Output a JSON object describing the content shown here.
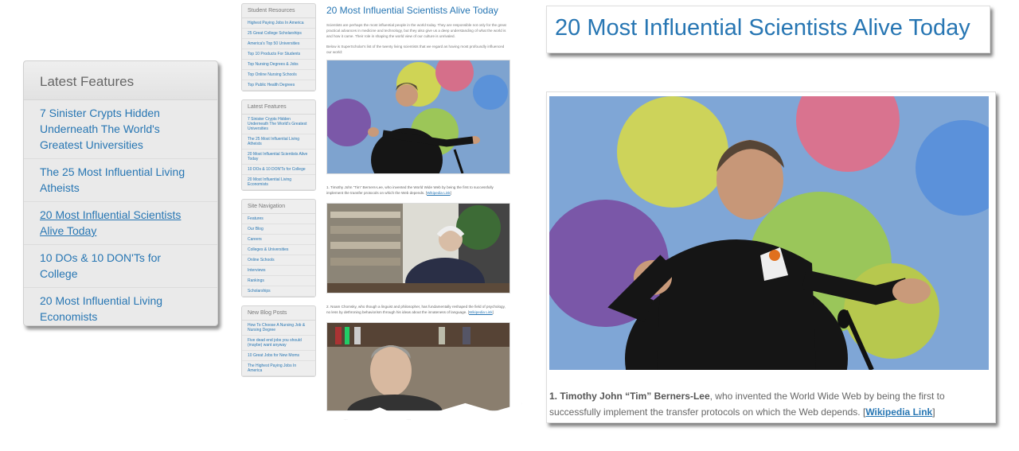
{
  "latest_features": {
    "heading": "Latest Features",
    "items": [
      {
        "line1": "7 Sinister Crypts Hidden",
        "line2": "Underneath The World's",
        "line3": "Greatest Universities"
      },
      {
        "line1": "The 25 Most Influential Living",
        "line2": "Atheists"
      },
      {
        "line1": "20 Most Influential Scientists",
        "line2": "Alive Today"
      },
      {
        "line1": "10 DOs & 10 DON'Ts for",
        "line2": "College"
      },
      {
        "line1": "20 Most Influential Living",
        "line2": "Economists"
      }
    ]
  },
  "sidebar": {
    "student_resources": {
      "heading": "Student Resources",
      "items": [
        "Highest Paying Jobs In America",
        "25 Great College Scholarships",
        "America's Top 50 Universities",
        "Top 10 Products For Students",
        "Top Nursing Degrees & Jobs",
        "Top Online Nursing Schools",
        "Top Public Health Degrees"
      ]
    },
    "latest_features": {
      "heading": "Latest Features",
      "items": [
        "7 Sinister Crypts Hidden Underneath The World's Greatest Universities",
        "The 25 Most Influential Living Atheists",
        "20 Most Influential Scientists Alive Today",
        "10 DOs & 10 DON'Ts for College",
        "20 Most Influential Living Economists"
      ]
    },
    "site_navigation": {
      "heading": "Site Navigation",
      "items": [
        "Features",
        "Our Blog",
        "Careers",
        "Colleges & Universities",
        "Online Schools",
        "Interviews",
        "Rankings",
        "Scholarships"
      ]
    },
    "new_blog_posts": {
      "heading": "New Blog Posts",
      "items": [
        "How To Choose A Nursing Job & Nursing Degree",
        "Five dead end jobs you should (maybe) want anyway",
        "10 Great Jobs for New Moms",
        "The Highest Paying Jobs In America"
      ]
    }
  },
  "article": {
    "title": "20 Most Influential Scientists Alive Today",
    "intro": "Scientists are perhaps the most influential people in the world today. They are responsible not only for the great practical advances in medicine and technology, but they also give us a deep understanding of what the world is and how it came. Their role in shaping the world view of our culture is unrivaled.",
    "intro2": "Below is SuperScholar's list of the twenty living scientists that we regard as having most profoundly influenced our world:",
    "entries": [
      {
        "num": "1.",
        "name": "Timothy John “Tim” Berners-Lee",
        "text": ", who invented the World Wide Web by being the first to successfully implement the transfer protocols on which the Web depends. ",
        "link": "Wikipedia Link"
      },
      {
        "num": "2.",
        "name": "Noam Chomsky",
        "text": ", who though a linguist and philosopher, has fundamentally reshaped the field of psychology, no less by dethroning behaviorism through his ideas about the innateness of language. ",
        "link": "Wikipedia Link"
      }
    ]
  },
  "banner_title": "20 Most Influential Scientists Alive Today",
  "colors": {
    "link": "#2776b3",
    "panel_bg": "#eaeaea",
    "text_gray": "#666666"
  }
}
